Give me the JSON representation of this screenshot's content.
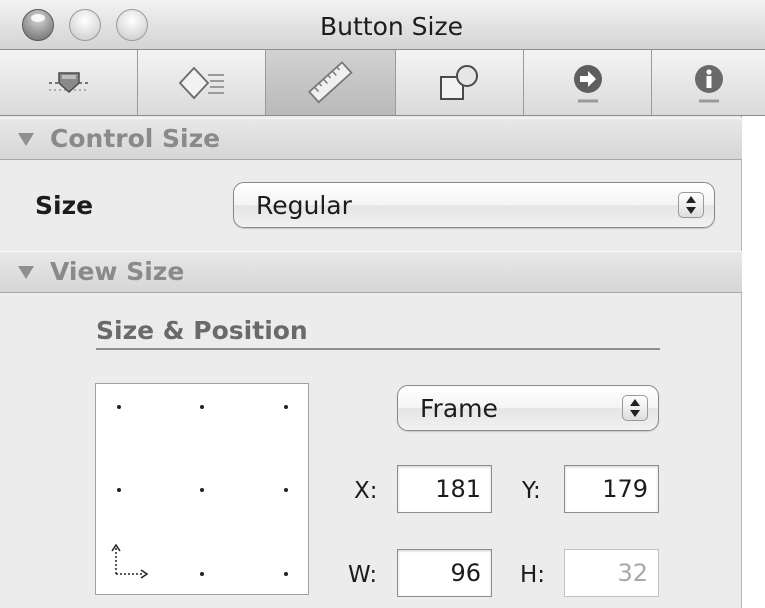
{
  "window": {
    "title": "Button Size",
    "controls": [
      "close",
      "minimize",
      "zoom"
    ]
  },
  "toolbar": {
    "tabs": [
      {
        "name": "attributes",
        "icon": "slider-attributes-icon",
        "selected": false
      },
      {
        "name": "effects",
        "icon": "diamond-effects-icon",
        "selected": false
      },
      {
        "name": "size",
        "icon": "ruler-icon",
        "selected": true
      },
      {
        "name": "bindings",
        "icon": "shapes-icon",
        "selected": false
      },
      {
        "name": "connections",
        "icon": "arrow-circle-icon",
        "selected": false
      },
      {
        "name": "identity",
        "icon": "info-icon",
        "selected": false
      }
    ]
  },
  "control_size": {
    "header": "Control Size",
    "size_label": "Size",
    "size_value": "Regular"
  },
  "view_size": {
    "header": "View Size",
    "subheading": "Size & Position",
    "frame_mode": "Frame",
    "x_label": "X:",
    "x_value": "181",
    "y_label": "Y:",
    "y_value": "179",
    "w_label": "W:",
    "w_value": "96",
    "h_label": "H:",
    "h_value": "32"
  },
  "colors": {
    "selected_tab": "#c4c4c4",
    "panel_bg": "#ececec",
    "disabled_text": "#a9a9a9"
  }
}
